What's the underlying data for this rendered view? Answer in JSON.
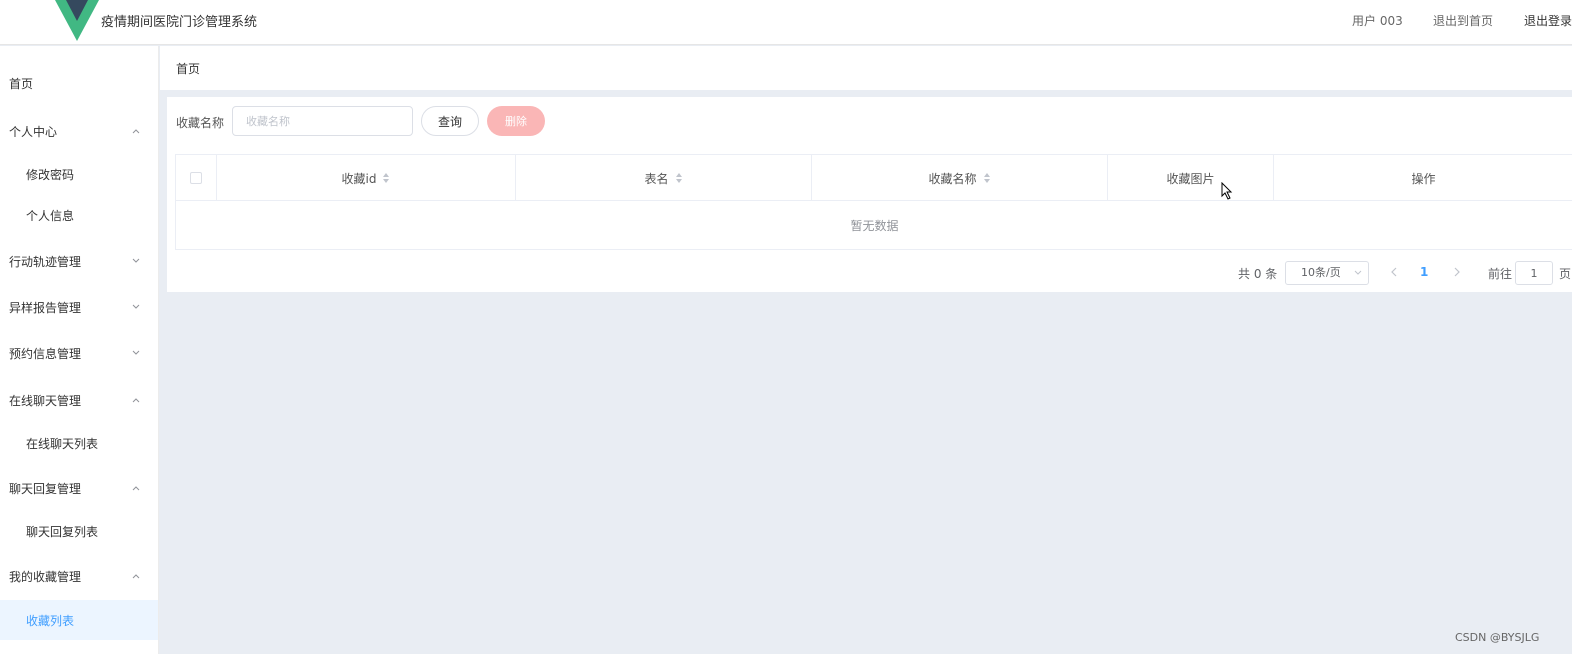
{
  "header": {
    "app_title": "疫情期间医院门诊管理系统",
    "user": "用户 003",
    "back_home": "退出到首页",
    "logout": "退出登录"
  },
  "colors": {
    "accent": "#409eff",
    "delete_disabled": "#fab6b6",
    "logo_outer": "#41b883",
    "logo_inner": "#35495e"
  },
  "sidebar": {
    "items": [
      {
        "label": "首页",
        "type": "top",
        "arrow": "none"
      },
      {
        "label": "个人中心",
        "type": "group",
        "arrow": "up"
      },
      {
        "label": "修改密码",
        "type": "sub"
      },
      {
        "label": "个人信息",
        "type": "sub"
      },
      {
        "label": "行动轨迹管理",
        "type": "group",
        "arrow": "down"
      },
      {
        "label": "异样报告管理",
        "type": "group",
        "arrow": "down"
      },
      {
        "label": "预约信息管理",
        "type": "group",
        "arrow": "down"
      },
      {
        "label": "在线聊天管理",
        "type": "group",
        "arrow": "up"
      },
      {
        "label": "在线聊天列表",
        "type": "sub"
      },
      {
        "label": "聊天回复管理",
        "type": "group",
        "arrow": "up"
      },
      {
        "label": "聊天回复列表",
        "type": "sub"
      },
      {
        "label": "我的收藏管理",
        "type": "group",
        "arrow": "up"
      },
      {
        "label": "收藏列表",
        "type": "sub",
        "active": true
      }
    ]
  },
  "breadcrumb": {
    "current": "首页"
  },
  "search": {
    "label": "收藏名称",
    "placeholder": "收藏名称",
    "value": "",
    "query_label": "查询",
    "delete_label": "删除"
  },
  "table": {
    "columns": [
      {
        "label": "",
        "type": "checkbox"
      },
      {
        "label": "收藏id",
        "sortable": true
      },
      {
        "label": "表名",
        "sortable": true
      },
      {
        "label": "收藏名称",
        "sortable": true
      },
      {
        "label": "收藏图片",
        "sortable": false
      },
      {
        "label": "操作",
        "sortable": false
      }
    ],
    "rows": [],
    "empty_text": "暂无数据"
  },
  "pagination": {
    "total_text": "共 0 条",
    "page_size": "10条/页",
    "current_page": "1",
    "goto_label": "前往",
    "goto_value": "1",
    "page_suffix": "页"
  },
  "watermark": "CSDN @BYSJLG"
}
